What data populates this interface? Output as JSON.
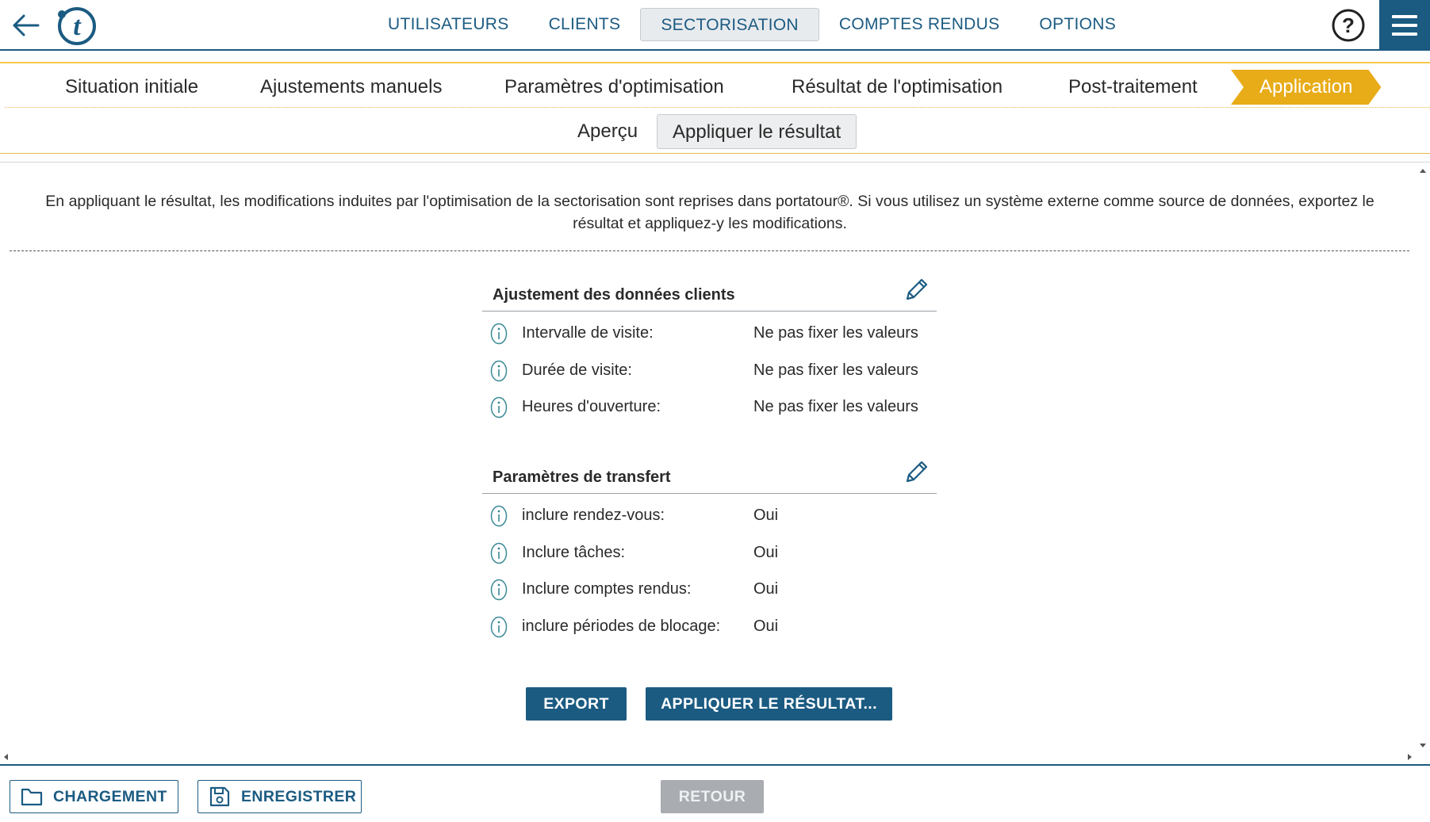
{
  "header": {
    "nav": [
      {
        "label": "UTILISATEURS",
        "active": false
      },
      {
        "label": "CLIENTS",
        "active": false
      },
      {
        "label": "SECTORISATION",
        "active": true
      },
      {
        "label": "COMPTES RENDUS",
        "active": false
      },
      {
        "label": "OPTIONS",
        "active": false
      }
    ],
    "help_label": "?",
    "colors": {
      "primary": "#1b5b82",
      "accent": "#e8ac18"
    }
  },
  "steps": [
    {
      "label": "Situation initiale",
      "active": false
    },
    {
      "label": "Ajustements manuels",
      "active": false
    },
    {
      "label": "Paramètres d'optimisation",
      "active": false
    },
    {
      "label": "Résultat de l'optimisation",
      "active": false
    },
    {
      "label": "Post-traitement",
      "active": false
    },
    {
      "label": "Application",
      "active": true
    }
  ],
  "subtabs": [
    {
      "label": "Aperçu",
      "active": false
    },
    {
      "label": "Appliquer le résultat",
      "active": true
    }
  ],
  "intro_text": "En appliquant le résultat, les modifications induites par l'optimisation de la sectorisation sont reprises dans portatour®. Si vous utilisez un système externe comme source de données, exportez le résultat et appliquez-y les modifications.",
  "sections": [
    {
      "title": "Ajustement des données clients",
      "rows": [
        {
          "label": "Intervalle de visite:",
          "value": "Ne pas fixer les valeurs"
        },
        {
          "label": "Durée de visite:",
          "value": "Ne pas fixer les valeurs"
        },
        {
          "label": "Heures d'ouverture:",
          "value": "Ne pas fixer les valeurs"
        }
      ]
    },
    {
      "title": "Paramètres de transfert",
      "rows": [
        {
          "label": "inclure rendez-vous:",
          "value": "Oui"
        },
        {
          "label": "Inclure tâches:",
          "value": "Oui"
        },
        {
          "label": "Inclure comptes rendus:",
          "value": "Oui"
        },
        {
          "label": "inclure périodes de blocage:",
          "value": "Oui"
        }
      ]
    }
  ],
  "actions": {
    "export_label": "EXPORT",
    "apply_label": "APPLIQUER LE RÉSULTAT..."
  },
  "footer": {
    "load_label": "CHARGEMENT",
    "save_label": "ENREGISTRER",
    "back_label": "RETOUR",
    "back_disabled": true
  },
  "icons": {
    "back": "arrow-left-icon",
    "logo": "portatour-logo",
    "help": "help-circle-icon",
    "menu": "hamburger-menu-icon",
    "edit": "pencil-icon",
    "info": "info-icon",
    "load": "folder-icon",
    "save": "floppy-disk-icon"
  }
}
